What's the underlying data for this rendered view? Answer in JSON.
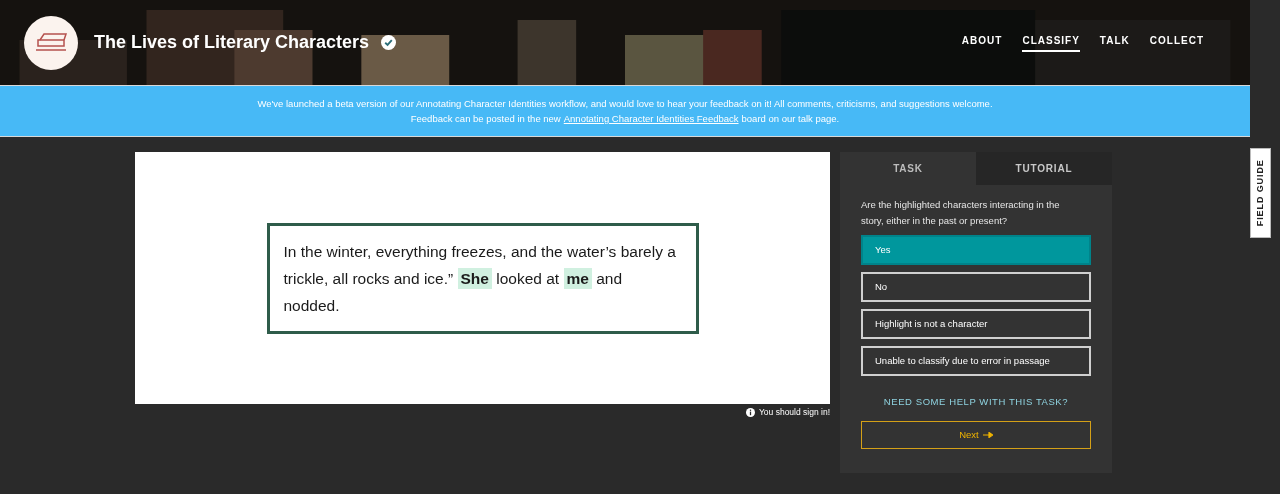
{
  "header": {
    "title": "The Lives of Literary Characters",
    "verified": true,
    "nav": [
      {
        "label": "ABOUT",
        "selected": false
      },
      {
        "label": "CLASSIFY",
        "selected": true
      },
      {
        "label": "TALK",
        "selected": false
      },
      {
        "label": "COLLECT",
        "selected": false
      }
    ]
  },
  "banner": {
    "line_1": "We've launched a beta version of our Annotating Character Identities workflow, and would love to hear your feedback on it! All comments, criticisms, and suggestions welcome.",
    "line_2_before": "Feedback can be posted in the new",
    "link": "Annotating Character Identities Feedback",
    "line_2_after": "board on our talk page."
  },
  "passage": [
    {
      "text": "In the winter, everything freezes, and the water’s barely a trickle, all rocks and ice.”",
      "highlighted": false
    },
    {
      "text": "She",
      "highlighted": true
    },
    {
      "text": "looked at",
      "highlighted": false
    },
    {
      "text": "me",
      "highlighted": true
    },
    {
      "text": "and nodded.",
      "highlighted": false
    }
  ],
  "sign_in_note": "You should sign in!",
  "task_panel": {
    "tabs": [
      {
        "label": "TASK",
        "selected": true
      },
      {
        "label": "TUTORIAL",
        "selected": false
      }
    ],
    "question": "Are the highlighted characters interacting in the story, either in the past or present?",
    "answers": [
      {
        "label": "Yes",
        "selected": true
      },
      {
        "label": "No",
        "selected": false
      },
      {
        "label": "Highlight is not a character",
        "selected": false
      },
      {
        "label": "Unable to classify due to error in passage",
        "selected": false
      }
    ],
    "help_link": "NEED SOME HELP WITH THIS TASK?",
    "next_button": "Next"
  },
  "field_guide": "FIELD GUIDE"
}
